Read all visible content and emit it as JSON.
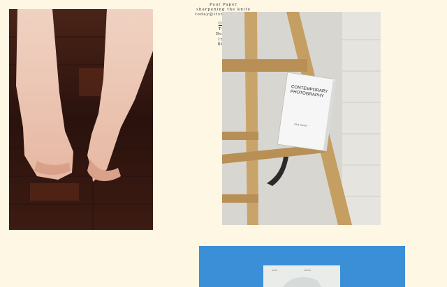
{
  "header": {
    "author": "Paul Paper",
    "tagline": "sharpening the knife",
    "email": "today@itsmeparty.org"
  },
  "nav": {
    "items": [
      {
        "label": "One",
        "active": true
      },
      {
        "label": "Two",
        "active": false
      },
      {
        "label": "Books",
        "active": false
      },
      {
        "label": "Info",
        "active": false
      },
      {
        "label": "Blog",
        "active": false
      }
    ]
  },
  "book": {
    "title_line1": "CONTEMPORARY",
    "title_line2": "PHOTOGRAPHY",
    "author": "PAUL PAPER"
  },
  "colors": {
    "background": "#fdf7e4",
    "text": "#333333",
    "blue_panel": "#3a8fd6"
  }
}
